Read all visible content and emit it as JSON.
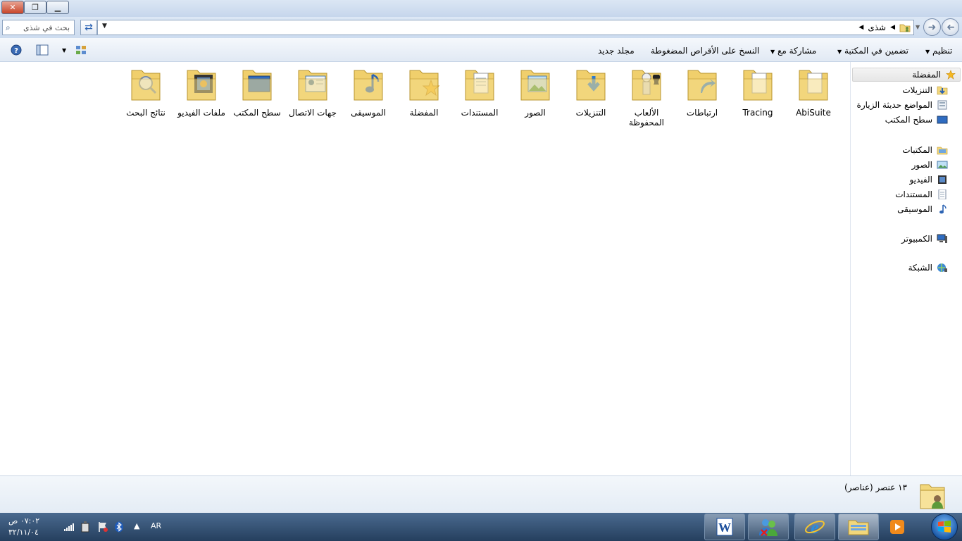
{
  "window": {
    "close_glyph": "✕",
    "restore_glyph": "❐",
    "min_glyph": "▁"
  },
  "address_bar": {
    "search_placeholder": "بحث في شذى",
    "breadcrumb_current": "شذى",
    "refresh_glyph": "⇄",
    "dropdown_glyph": "▼"
  },
  "toolbar": {
    "organize": "تنظيم",
    "include_in_library": "تضمين في المكتبة",
    "share_with": "مشاركة مع",
    "burn": "النسخ على الأقراص المضغوطة",
    "new_folder": "مجلد جديد"
  },
  "folders": [
    {
      "label": "AbiSuite",
      "overlay": "file"
    },
    {
      "label": "Tracing",
      "overlay": "file"
    },
    {
      "label": "ارتباطات",
      "overlay": "link"
    },
    {
      "label": "الألعاب المحفوظة",
      "overlay": "games"
    },
    {
      "label": "التنزيلات",
      "overlay": "download"
    },
    {
      "label": "الصور",
      "overlay": "picture"
    },
    {
      "label": "المستندات",
      "overlay": "document"
    },
    {
      "label": "المفضلة",
      "overlay": "star"
    },
    {
      "label": "الموسيقى",
      "overlay": "music"
    },
    {
      "label": "جهات الاتصال",
      "overlay": "contact"
    },
    {
      "label": "سطح المكتب",
      "overlay": "desktop"
    },
    {
      "label": "ملفات الفيديو",
      "overlay": "video"
    },
    {
      "label": "نتائج البحث",
      "overlay": "search"
    }
  ],
  "nav": {
    "favorites": "المفضلة",
    "downloads": "التنزيلات",
    "recent_places": "المواضع حديثة الزيارة",
    "desktop": "سطح المكتب",
    "libraries": "المكتبات",
    "pictures": "الصور",
    "videos": "الفيديو",
    "documents": "المستندات",
    "music": "الموسيقى",
    "computer": "الكمبيوتر",
    "network": "الشبكة"
  },
  "details": {
    "item_count": "١٣ عنصر (عناصر)"
  },
  "taskbar": {
    "time": "٠٧:٠٢ ص",
    "date": "٣٢/١١/٠٤",
    "language": "AR"
  },
  "colors": {
    "folder": "#f2d77b",
    "accent": "#2c63b3",
    "taskbar": "#36557a"
  }
}
